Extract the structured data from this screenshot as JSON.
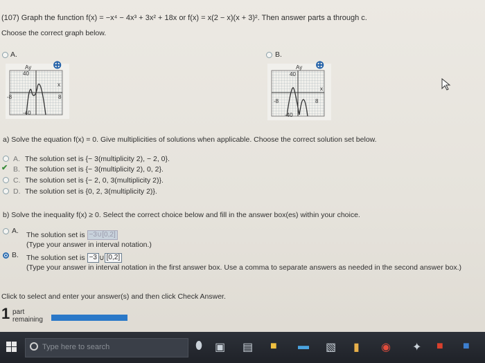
{
  "question": {
    "header": "(107) Graph the function f(x) = −x⁴ − 4x³ + 3x² + 18x or f(x) = x(2 − x)(x + 3)². Then answer parts a through c.",
    "instruction": "Choose the correct graph below."
  },
  "graph_choices": {
    "a_label": "A.",
    "b_label": "B.",
    "a_ticks": {
      "y_top": "40",
      "y_bottom": "-40",
      "x_left": "-8",
      "x_right": "8",
      "x_axis": "x",
      "y_axis": "Ay"
    },
    "b_ticks": {
      "y_top": "40",
      "y_bottom": "-40",
      "x_left": "-8",
      "x_right": "8",
      "x_axis": "x",
      "y_axis": "Ay"
    }
  },
  "part_a": {
    "prompt": "a) Solve the equation f(x) = 0. Give multiplicities of solutions when applicable. Choose the correct solution set below.",
    "options": [
      {
        "letter": "A.",
        "text": "The solution set is {− 3(multiplicity 2), − 2, 0}."
      },
      {
        "letter": "B.",
        "text": "The solution set is {− 3(multiplicity 2), 0, 2}."
      },
      {
        "letter": "C.",
        "text": "The solution set is {− 2, 0, 3(multiplicity 2)}."
      },
      {
        "letter": "D.",
        "text": "The solution set is {0, 2, 3(multiplicity 2)}."
      }
    ]
  },
  "part_b": {
    "prompt": "b) Solve the inequality f(x) ≥ 0. Select the correct choice below and fill in the answer box(es) within your choice.",
    "option_a": {
      "letter": "A.",
      "text": "The solution set is",
      "box": "−3∪[0,2]",
      "hint": "(Type your answer in interval notation.)"
    },
    "option_b": {
      "letter": "B.",
      "text": "The solution set is",
      "box1": "−3",
      "union": "∪",
      "box2": "[0,2]",
      "hint": "(Type your answer in interval notation in the first answer box. Use a comma to separate answers as needed in the second answer box.)"
    }
  },
  "footer": {
    "instruction": "Click to select and enter your answer(s) and then click Check Answer.",
    "part_count": "1",
    "part_word": "part",
    "remaining": "remaining"
  },
  "taskbar": {
    "search_placeholder": "Type here to search"
  },
  "colors": {
    "accent": "#2b6cb0",
    "progress": "#2a78c8",
    "correct": "#3a8c3a"
  }
}
